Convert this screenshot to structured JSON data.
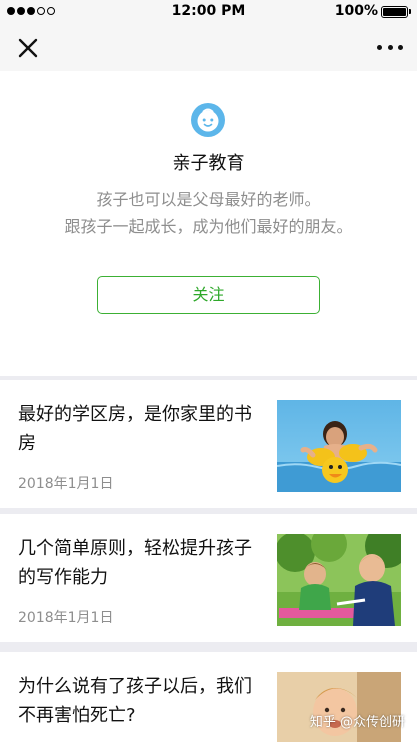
{
  "status_bar": {
    "time": "12:00 PM",
    "battery_percent": "100%",
    "signal_dots_filled": 3,
    "signal_dots_total": 5
  },
  "nav": {
    "close_icon": "close-icon",
    "more_icon": "more-icon"
  },
  "profile": {
    "avatar_icon": "baby-face-icon",
    "name": "亲子教育",
    "description_line1": "孩子也可以是父母最好的老师。",
    "description_line2": "跟孩子一起成长，成为他们最好的朋友。",
    "follow_label": "关注"
  },
  "articles": [
    {
      "title": "最好的学区房，是你家里的书房",
      "date": "2018年1月1日"
    },
    {
      "title": "几个简单原则，轻松提升孩子的写作能力",
      "date": "2018年1月1日"
    },
    {
      "title": "为什么说有了孩子以后，我们不再害怕死亡?",
      "date": ""
    }
  ],
  "watermark": "知乎 @众传创研",
  "colors": {
    "accent_green": "#3cb034",
    "avatar_blue": "#5cb6ea",
    "muted_text": "#8e8e8e",
    "page_background": "#ececf1"
  }
}
